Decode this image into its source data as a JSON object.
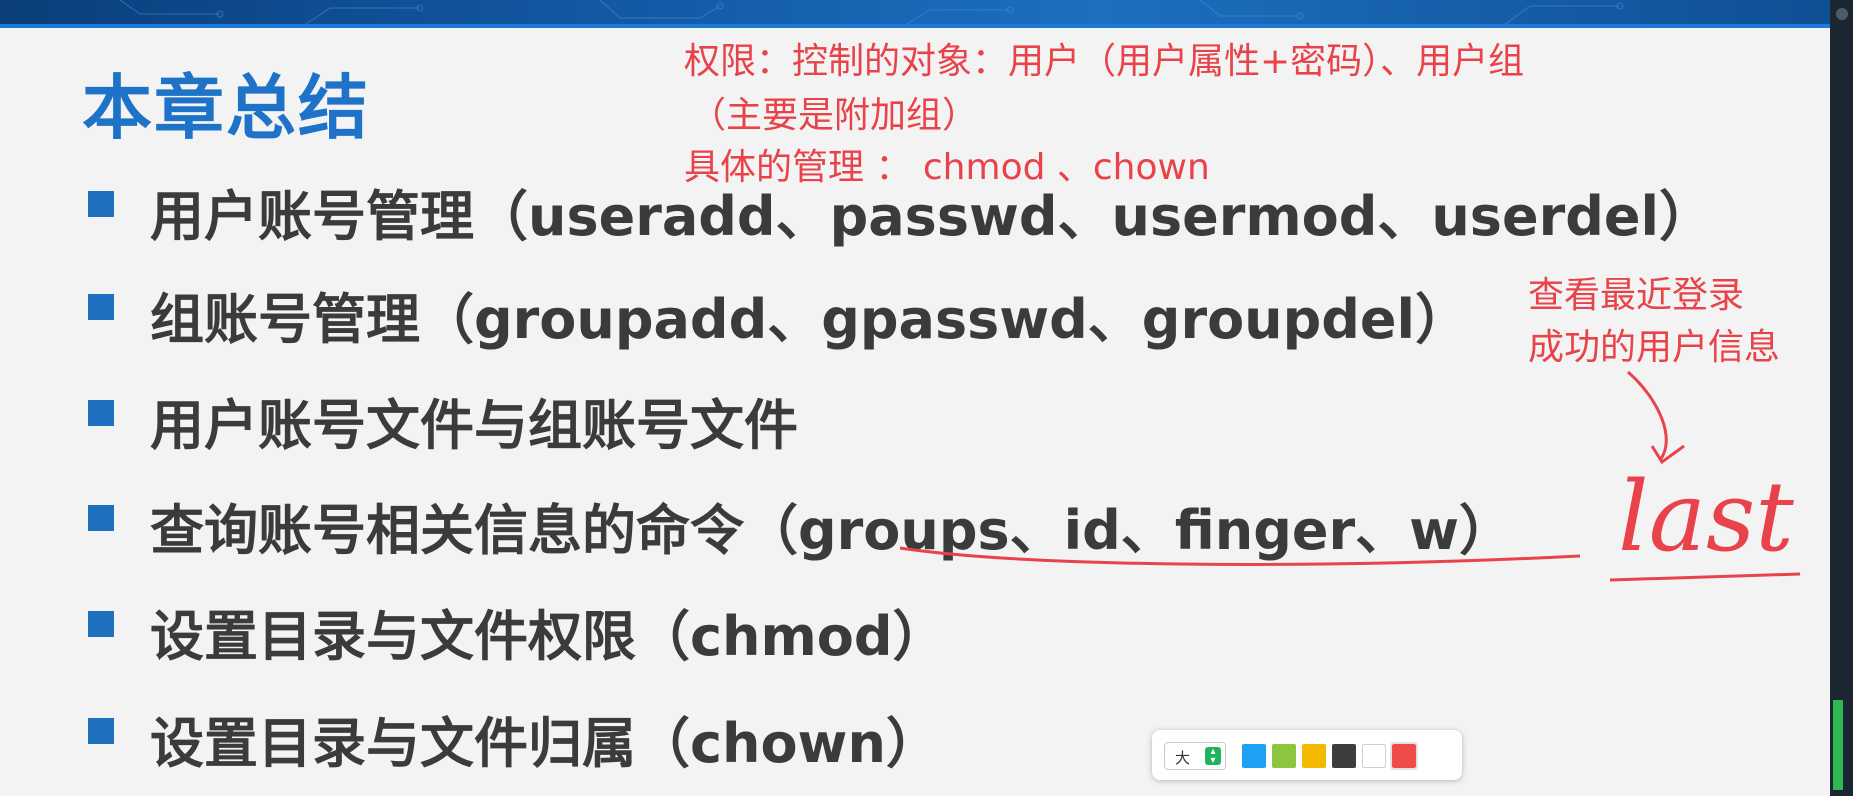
{
  "slide": {
    "title": "本章总结",
    "items": [
      {
        "text": "用户账号管理（useradd、passwd、usermod、userdel）"
      },
      {
        "text": "组账号管理（groupadd、gpasswd、groupdel）"
      },
      {
        "text": "用户账号文件与组账号文件"
      },
      {
        "text": "查询账号相关信息的命令（groups、id、finger、w）"
      },
      {
        "text": "设置目录与文件权限（chmod）"
      },
      {
        "text": "设置目录与文件归属（chown）"
      }
    ]
  },
  "annotations": {
    "note1_line1": "权限：控制的对象：用户（用户属性+密码）、用户组",
    "note1_line2": "（主要是附加组）",
    "note1_line3": "具体的管理 ： chmod 、chown",
    "note2_line1": "查看最近登录",
    "note2_line2": "成功的用户信息",
    "handwritten_word": "last"
  },
  "pen_toolbar": {
    "size_label": "大",
    "colors": [
      {
        "name": "blue",
        "hex": "#1ea1f2"
      },
      {
        "name": "green",
        "hex": "#8cc63f"
      },
      {
        "name": "yellow",
        "hex": "#f5b800"
      },
      {
        "name": "dark-gray",
        "hex": "#3d3d3d"
      },
      {
        "name": "white",
        "hex": "#ffffff"
      },
      {
        "name": "red",
        "hex": "#ef4b4b",
        "selected": true
      }
    ]
  },
  "colors": {
    "title_blue": "#1e73c8",
    "bullet_blue": "#1e6fbe",
    "body_text": "#3b3b3b",
    "annotation_red": "#e8434a"
  }
}
